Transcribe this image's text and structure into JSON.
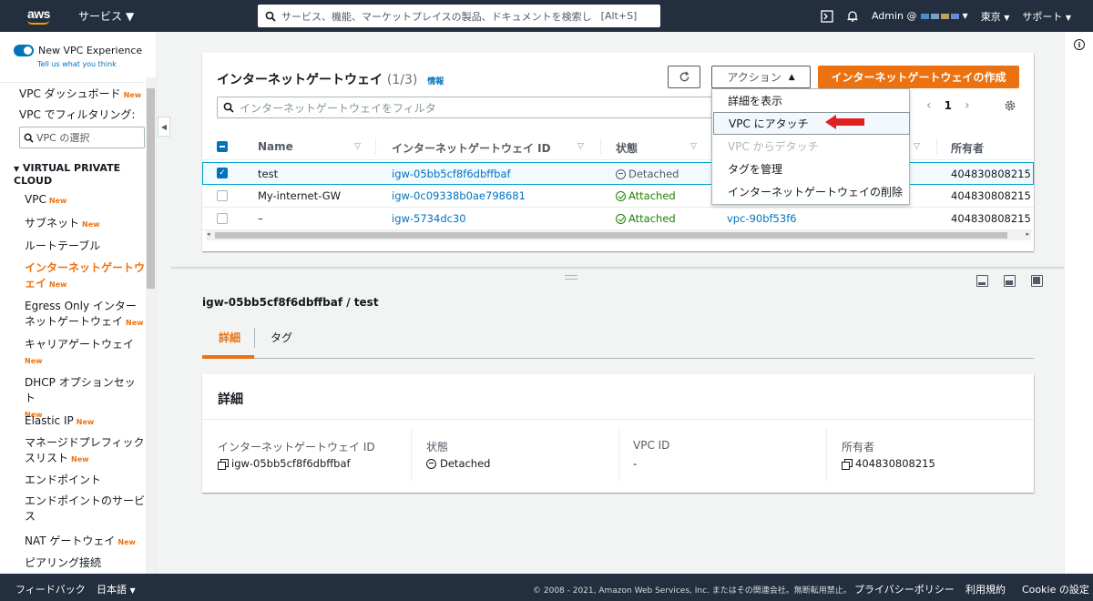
{
  "topnav": {
    "logo": "aws",
    "services": "サービス",
    "search_placeholder": "サービス、機能、マーケットプレイスの製品、ドキュメントを検索し",
    "search_shortcut": "[Alt+S]",
    "account": "Admin @",
    "region": "東京",
    "support": "サポート"
  },
  "sidebar": {
    "new_vpc_experience": "New VPC Experience",
    "tell_us": "Tell us what you think",
    "dashboard": "VPC ダッシュボード",
    "filter_label": "VPC でフィルタリング:",
    "vpc_select": "VPC の選択",
    "section": "VIRTUAL PRIVATE CLOUD",
    "new_badge": "New",
    "items": [
      "VPC",
      "サブネット",
      "ルートテーブル",
      "インターネットゲートウェイ",
      "Egress Only インターネットゲートウェイ",
      "キャリアゲートウェイ",
      "DHCP オプションセット",
      "Elastic IP",
      "マネージドプレフィックスリスト",
      "エンドポイント",
      "エンドポイントのサービス",
      "NAT ゲートウェイ",
      "ピアリング接続"
    ]
  },
  "table": {
    "title": "インターネットゲートウェイ",
    "count": "(1/3)",
    "info": "情報",
    "actions": "アクション",
    "create": "インターネットゲートウェイの作成",
    "filter_placeholder": "インターネットゲートウェイをフィルタ",
    "page": "1",
    "columns": [
      "Name",
      "インターネットゲートウェイ ID",
      "状態",
      "所有者"
    ],
    "rows": [
      {
        "name": "test",
        "id": "igw-05bb5cf8f6dbffbaf",
        "state": "Detached",
        "vpc": "",
        "owner": "404830808215"
      },
      {
        "name": "My-internet-GW",
        "id": "igw-0c09338b0ae798681",
        "state": "Attached",
        "vpc": "",
        "owner": "404830808215"
      },
      {
        "name": "–",
        "id": "igw-5734dc30",
        "state": "Attached",
        "vpc": "vpc-90bf53f6",
        "owner": "404830808215"
      }
    ]
  },
  "dropdown": {
    "items": [
      "詳細を表示",
      "VPC にアタッチ",
      "VPC からデタッチ",
      "タグを管理",
      "インターネットゲートウェイの削除"
    ]
  },
  "detail": {
    "title": "igw-05bb5cf8f6dbffbaf / test",
    "tabs": [
      "詳細",
      "タグ"
    ],
    "card_title": "詳細",
    "fields": [
      {
        "label": "インターネットゲートウェイ ID",
        "value": "igw-05bb5cf8f6dbffbaf"
      },
      {
        "label": "状態",
        "value": "Detached"
      },
      {
        "label": "VPC ID",
        "value": "-"
      },
      {
        "label": "所有者",
        "value": "404830808215"
      }
    ]
  },
  "footer": {
    "feedback": "フィードバック",
    "language": "日本語",
    "copyright": "© 2008 - 2021, Amazon Web Services, Inc. またはその関連会社。無断転用禁止。",
    "privacy": "プライバシーポリシー",
    "terms": "利用規約",
    "cookie": "Cookie の設定"
  },
  "colors": {
    "nav": "#232f3e",
    "accent": "#ec7211",
    "link": "#0073bb",
    "attached": "#1d8102",
    "arrow": "#e02020"
  }
}
